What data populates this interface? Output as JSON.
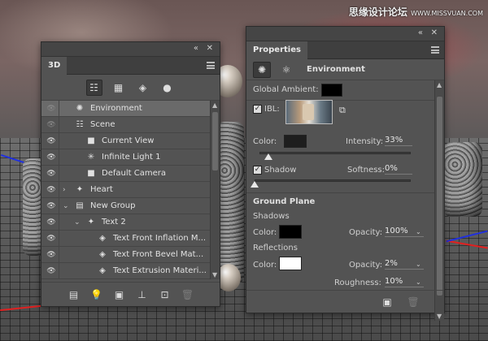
{
  "watermark": {
    "main": "思缘设计论坛",
    "sub": "WWW.MISSVUAN.COM"
  },
  "icons": {
    "visibility": "eye-icon",
    "scene_filter": "scene-filter-icon",
    "mesh_filter": "mesh-filter-icon",
    "material_filter": "material-filter-icon",
    "light_filter": "light-filter-icon"
  },
  "panel3d": {
    "tab": "3D",
    "layers": [
      {
        "label": "Environment",
        "icon": "environment-icon",
        "indent": 0,
        "twisty": "",
        "selected": true,
        "eye": false
      },
      {
        "label": "Scene",
        "icon": "scene-icon",
        "indent": 0,
        "twisty": "",
        "selected": false,
        "eye": false
      },
      {
        "label": "Current View",
        "icon": "camera-icon",
        "indent": 1,
        "twisty": "",
        "selected": false,
        "eye": true
      },
      {
        "label": "Infinite Light 1",
        "icon": "light-icon",
        "indent": 1,
        "twisty": "",
        "selected": false,
        "eye": true
      },
      {
        "label": "Default Camera",
        "icon": "camera-icon",
        "indent": 1,
        "twisty": "",
        "selected": false,
        "eye": true
      },
      {
        "label": "Heart",
        "icon": "mesh-icon",
        "indent": 0,
        "twisty": "›",
        "selected": false,
        "eye": true
      },
      {
        "label": "New Group",
        "icon": "group-icon",
        "indent": 0,
        "twisty": "⌄",
        "selected": false,
        "eye": true
      },
      {
        "label": "Text 2",
        "icon": "mesh-icon",
        "indent": 1,
        "twisty": "⌄",
        "selected": false,
        "eye": true
      },
      {
        "label": "Text Front Inflation M...",
        "icon": "material-icon",
        "indent": 2,
        "twisty": "",
        "selected": false,
        "eye": true
      },
      {
        "label": "Text Front Bevel Mat...",
        "icon": "material-icon",
        "indent": 2,
        "twisty": "",
        "selected": false,
        "eye": true
      },
      {
        "label": "Text Extrusion Materi...",
        "icon": "material-icon",
        "indent": 2,
        "twisty": "",
        "selected": false,
        "eye": true
      }
    ]
  },
  "properties": {
    "tab": "Properties",
    "section_title": "Environment",
    "global_ambient_label": "Global Ambient:",
    "global_ambient_color": "#000000",
    "ibl_label": "IBL:",
    "ibl_checked": true,
    "color_label": "Color:",
    "ibl_color": "#1e1e1e",
    "intensity_label": "Intensity:",
    "intensity_value": "33%",
    "intensity_fraction": 0.03,
    "shadow_label": "Shadow",
    "shadow_checked": true,
    "softness_label": "Softness:",
    "softness_value": "0%",
    "softness_fraction": 0.0,
    "ground_plane_title": "Ground Plane",
    "shadows_label": "Shadows",
    "shadows_color_label": "Color:",
    "shadows_color": "#000000",
    "shadows_opacity_label": "Opacity:",
    "shadows_opacity_value": "100%",
    "reflections_label": "Reflections",
    "reflections_color_label": "Color:",
    "reflections_color": "#ffffff",
    "reflections_opacity_label": "Opacity:",
    "reflections_opacity_value": "2%",
    "roughness_label": "Roughness:",
    "roughness_value": "10%"
  }
}
